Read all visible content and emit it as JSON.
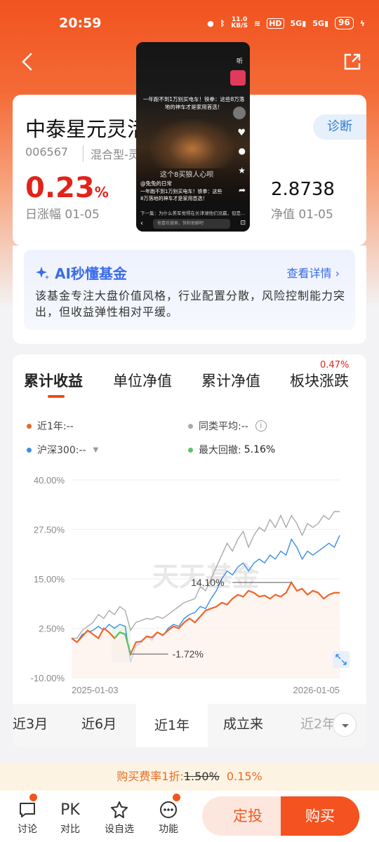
{
  "status": {
    "time": "20:59",
    "net_speed": "11.0\nKB/S",
    "battery": "96"
  },
  "header": {
    "back_icon": "back-arrow-icon",
    "share_icon": "share-icon"
  },
  "fund": {
    "name": "中泰星元灵活",
    "code": "006567",
    "type": "混合型-灵",
    "diagnose_label": "诊断",
    "daily_rate": "0.23",
    "daily_rate_unit": "%",
    "daily_rate_label": "日涨幅 01-05",
    "nav": "2.8738",
    "nav_label": "净值 01-05"
  },
  "ai": {
    "title": "AI秒懂基金",
    "more": "查看详情",
    "text": "该基金专注大盘价值风格，行业配置分散，风险控制能力突出，但收益弹性相对平缓。"
  },
  "chart_tabs": [
    {
      "label": "累计收益",
      "active": true
    },
    {
      "label": "单位净值"
    },
    {
      "label": "累计净值"
    },
    {
      "label": "板块涨跌",
      "badge": "0.47%"
    }
  ],
  "legend": {
    "fund": "近1年:--",
    "peer": "同类平均:--",
    "index": "沪深300:--",
    "drawdown_label": "最大回撤:",
    "drawdown_value": "5.16%"
  },
  "watermark": "天天基金",
  "chart_data": {
    "type": "line",
    "y_ticks": [
      "40.00%",
      "27.50%",
      "15.00%",
      "2.50%",
      "-10.00%"
    ],
    "ylim": [
      -10,
      40
    ],
    "x_labels": [
      "2025-01-03",
      "2026-01-05"
    ],
    "annotations": [
      "14.10%",
      "-1.72%"
    ],
    "colors": {
      "fund": "#f0642a",
      "index": "#3a8ee6",
      "peer": "#aaaaaa",
      "drawdown": "#5cc36a"
    },
    "series": [
      {
        "key": "fund",
        "values": [
          0,
          -1,
          0.5,
          2,
          1,
          0,
          2.5,
          1.5,
          0,
          1.5,
          1,
          -4,
          -1,
          -0.8,
          0.5,
          0.2,
          1.5,
          0.8,
          2,
          3,
          2.5,
          4,
          5,
          4,
          5.5,
          7,
          7.5,
          8,
          9,
          8.5,
          10,
          11,
          10.5,
          12,
          11.5,
          10.5,
          10.8,
          10,
          11,
          10.5,
          11.5,
          14.1,
          12,
          12.5,
          11,
          12,
          11.5,
          10,
          11,
          11.5,
          11.5
        ]
      },
      {
        "key": "index",
        "values": [
          0,
          -1,
          1,
          1.5,
          2,
          3,
          2,
          3.5,
          2.5,
          3.5,
          3,
          -6,
          -2,
          -1,
          0.5,
          -0.5,
          1.5,
          0.5,
          2.5,
          3.5,
          3,
          5,
          6,
          6.5,
          8,
          7.5,
          10,
          12,
          15,
          17,
          16,
          18,
          19,
          17,
          19,
          20,
          19,
          21,
          20,
          22,
          21,
          25,
          23,
          20,
          22,
          21,
          22,
          23,
          24,
          23,
          26
        ]
      },
      {
        "key": "peer",
        "values": [
          0,
          0,
          2,
          3,
          4,
          6,
          5,
          7,
          6,
          8,
          7,
          2,
          4,
          4.5,
          5,
          4.8,
          5.5,
          5,
          6,
          7,
          8,
          9,
          9.5,
          10,
          13,
          12,
          15,
          18,
          21,
          24,
          22,
          25,
          27,
          23,
          26,
          28,
          27,
          30,
          28,
          31,
          28,
          31,
          29,
          26,
          29,
          28,
          29,
          31,
          30,
          32,
          32
        ]
      }
    ]
  },
  "ranges": [
    "近3月",
    "近6月",
    "近1年",
    "成立来",
    "近2年"
  ],
  "active_range": "近1年",
  "promo": {
    "prefix": "购买费率1折:",
    "old": "1.50%",
    "new": "0.15%"
  },
  "bottom_bar": {
    "discuss": "讨论",
    "compare_top": "PK",
    "compare": "对比",
    "watch": "设自选",
    "functions": "功能",
    "plan_button": "定投",
    "buy_button": "购买"
  },
  "pip_video": {
    "caption": "一年跑不到1万别买电车！铁拳：这些8万落地的神车才是家用首选！",
    "account": "@兔兔的日常",
    "subtitle": "这个8买狼人心呗",
    "next": "下一集：为什么美军觉得在长津湖他们没赢，但是...",
    "input_placeholder": "他喜欢搜索，快和他聊吧",
    "follow": "关注",
    "share": "分享",
    "listen": "听"
  }
}
